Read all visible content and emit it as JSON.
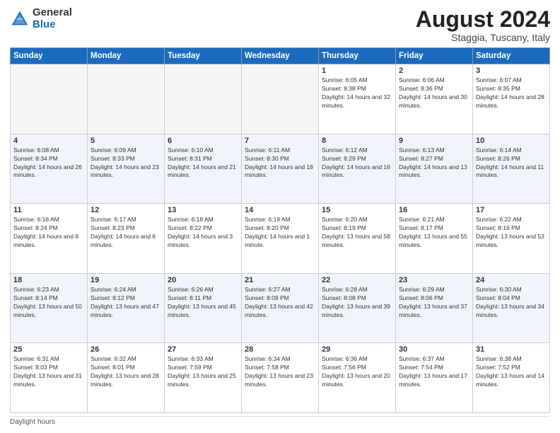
{
  "header": {
    "logo_general": "General",
    "logo_blue": "Blue",
    "month_title": "August 2024",
    "subtitle": "Staggia, Tuscany, Italy"
  },
  "days_of_week": [
    "Sunday",
    "Monday",
    "Tuesday",
    "Wednesday",
    "Thursday",
    "Friday",
    "Saturday"
  ],
  "footer": {
    "label": "Daylight hours"
  },
  "weeks": [
    [
      {
        "day": "",
        "empty": true
      },
      {
        "day": "",
        "empty": true
      },
      {
        "day": "",
        "empty": true
      },
      {
        "day": "",
        "empty": true
      },
      {
        "day": "1",
        "sunrise": "6:05 AM",
        "sunset": "8:38 PM",
        "daylight": "14 hours and 32 minutes."
      },
      {
        "day": "2",
        "sunrise": "6:06 AM",
        "sunset": "8:36 PM",
        "daylight": "14 hours and 30 minutes."
      },
      {
        "day": "3",
        "sunrise": "6:07 AM",
        "sunset": "8:35 PM",
        "daylight": "14 hours and 28 minutes."
      }
    ],
    [
      {
        "day": "4",
        "sunrise": "6:08 AM",
        "sunset": "8:34 PM",
        "daylight": "14 hours and 26 minutes."
      },
      {
        "day": "5",
        "sunrise": "6:09 AM",
        "sunset": "8:33 PM",
        "daylight": "14 hours and 23 minutes."
      },
      {
        "day": "6",
        "sunrise": "6:10 AM",
        "sunset": "8:31 PM",
        "daylight": "14 hours and 21 minutes."
      },
      {
        "day": "7",
        "sunrise": "6:11 AM",
        "sunset": "8:30 PM",
        "daylight": "14 hours and 18 minutes."
      },
      {
        "day": "8",
        "sunrise": "6:12 AM",
        "sunset": "8:29 PM",
        "daylight": "14 hours and 16 minutes."
      },
      {
        "day": "9",
        "sunrise": "6:13 AM",
        "sunset": "8:27 PM",
        "daylight": "14 hours and 13 minutes."
      },
      {
        "day": "10",
        "sunrise": "6:14 AM",
        "sunset": "8:26 PM",
        "daylight": "14 hours and 11 minutes."
      }
    ],
    [
      {
        "day": "11",
        "sunrise": "6:16 AM",
        "sunset": "8:24 PM",
        "daylight": "14 hours and 8 minutes."
      },
      {
        "day": "12",
        "sunrise": "6:17 AM",
        "sunset": "8:23 PM",
        "daylight": "14 hours and 6 minutes."
      },
      {
        "day": "13",
        "sunrise": "6:18 AM",
        "sunset": "8:22 PM",
        "daylight": "14 hours and 3 minutes."
      },
      {
        "day": "14",
        "sunrise": "6:19 AM",
        "sunset": "8:20 PM",
        "daylight": "14 hours and 1 minute."
      },
      {
        "day": "15",
        "sunrise": "6:20 AM",
        "sunset": "8:19 PM",
        "daylight": "13 hours and 58 minutes."
      },
      {
        "day": "16",
        "sunrise": "6:21 AM",
        "sunset": "8:17 PM",
        "daylight": "13 hours and 55 minutes."
      },
      {
        "day": "17",
        "sunrise": "6:22 AM",
        "sunset": "8:16 PM",
        "daylight": "13 hours and 53 minutes."
      }
    ],
    [
      {
        "day": "18",
        "sunrise": "6:23 AM",
        "sunset": "8:14 PM",
        "daylight": "13 hours and 50 minutes."
      },
      {
        "day": "19",
        "sunrise": "6:24 AM",
        "sunset": "8:12 PM",
        "daylight": "13 hours and 47 minutes."
      },
      {
        "day": "20",
        "sunrise": "6:26 AM",
        "sunset": "8:11 PM",
        "daylight": "13 hours and 45 minutes."
      },
      {
        "day": "21",
        "sunrise": "6:27 AM",
        "sunset": "8:09 PM",
        "daylight": "13 hours and 42 minutes."
      },
      {
        "day": "22",
        "sunrise": "6:28 AM",
        "sunset": "8:08 PM",
        "daylight": "13 hours and 39 minutes."
      },
      {
        "day": "23",
        "sunrise": "6:29 AM",
        "sunset": "8:06 PM",
        "daylight": "13 hours and 37 minutes."
      },
      {
        "day": "24",
        "sunrise": "6:30 AM",
        "sunset": "8:04 PM",
        "daylight": "13 hours and 34 minutes."
      }
    ],
    [
      {
        "day": "25",
        "sunrise": "6:31 AM",
        "sunset": "8:03 PM",
        "daylight": "13 hours and 31 minutes."
      },
      {
        "day": "26",
        "sunrise": "6:32 AM",
        "sunset": "8:01 PM",
        "daylight": "13 hours and 28 minutes."
      },
      {
        "day": "27",
        "sunrise": "6:33 AM",
        "sunset": "7:59 PM",
        "daylight": "13 hours and 25 minutes."
      },
      {
        "day": "28",
        "sunrise": "6:34 AM",
        "sunset": "7:58 PM",
        "daylight": "13 hours and 23 minutes."
      },
      {
        "day": "29",
        "sunrise": "6:36 AM",
        "sunset": "7:56 PM",
        "daylight": "13 hours and 20 minutes."
      },
      {
        "day": "30",
        "sunrise": "6:37 AM",
        "sunset": "7:54 PM",
        "daylight": "13 hours and 17 minutes."
      },
      {
        "day": "31",
        "sunrise": "6:38 AM",
        "sunset": "7:52 PM",
        "daylight": "13 hours and 14 minutes."
      }
    ]
  ]
}
